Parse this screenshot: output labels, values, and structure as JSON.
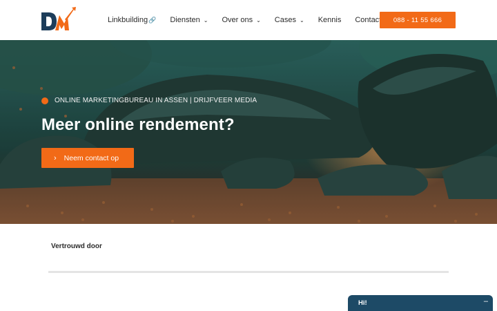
{
  "header": {
    "logo_text": "DM",
    "nav": [
      {
        "label": "Linkbuilding",
        "icon": "link-icon",
        "dropdown": false
      },
      {
        "label": "Diensten",
        "icon": "chevron-down-icon",
        "dropdown": true
      },
      {
        "label": "Over ons",
        "icon": "chevron-down-icon",
        "dropdown": true
      },
      {
        "label": "Cases",
        "icon": "chevron-down-icon",
        "dropdown": true
      },
      {
        "label": "Kennis",
        "dropdown": false
      },
      {
        "label": "Contact",
        "dropdown": false
      }
    ],
    "phone_button": "088 - 11 55 666"
  },
  "hero": {
    "label": "ONLINE MARKETINGBUREAU IN ASSEN | DRIJFVEER MEDIA",
    "title": "Meer online rendement?",
    "cta": "Neem contact op"
  },
  "trusted": {
    "label": "Vertrouwd door"
  },
  "chat": {
    "title": "Hi!",
    "minimize": "–"
  },
  "colors": {
    "accent": "#f26a17",
    "logo_navy": "#1d3d5a",
    "chat_bg": "#1d4a66"
  }
}
